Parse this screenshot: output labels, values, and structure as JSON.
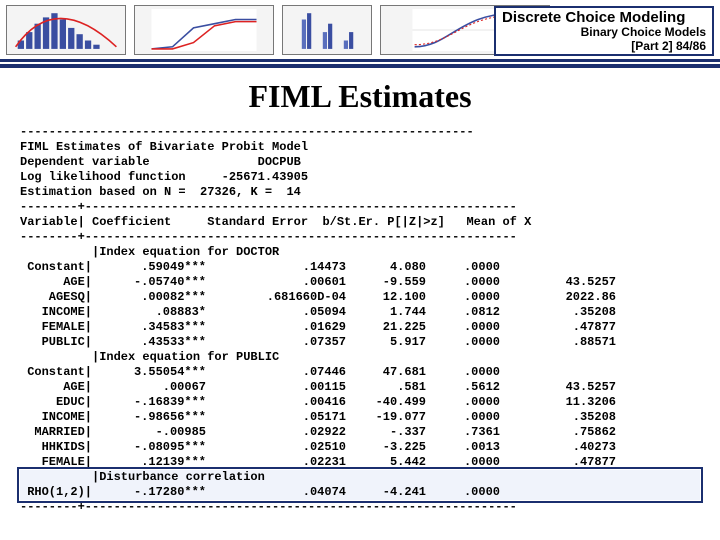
{
  "header": {
    "title_line1": "Discrete Choice Modeling",
    "title_line2": "Binary Choice Models",
    "part_label": "[Part 2]   84/86"
  },
  "main_title": "FIML Estimates",
  "preamble": {
    "dash_line": "---------------------------------------------------------------",
    "l1": "FIML Estimates of Bivariate Probit Model",
    "l2": "Dependent variable               DOCPUB",
    "l3": "Log likelihood function     -25671.43905",
    "l4": "Estimation based on N =  27326, K =  14",
    "sep": "--------+------------------------------------------------------------",
    "colhead": "Variable| Coefficient     Standard Error  b/St.Er. P[|Z|>z]   Mean of X"
  },
  "section1_label": "|Index     equation for DOCTOR",
  "section2_label": "|Index     equation for PUBLIC",
  "section3_label": "|Disturbance correlation",
  "closing_sep": "--------+------------------------------------------------------------",
  "rows_doctor": [
    {
      "var": "Constant|",
      "coef": ".59049***",
      "se": ".14473",
      "t": "4.080",
      "p": ".0000",
      "mx": ""
    },
    {
      "var": "AGE|",
      "coef": "-.05740***",
      "se": ".00601",
      "t": "-9.559",
      "p": ".0000",
      "mx": "43.5257"
    },
    {
      "var": "AGESQ|",
      "coef": ".00082***",
      "se": ".681660D-04",
      "t": "12.100",
      "p": ".0000",
      "mx": "2022.86"
    },
    {
      "var": "INCOME|",
      "coef": ".08883*",
      "se": ".05094",
      "t": "1.744",
      "p": ".0812",
      "mx": ".35208"
    },
    {
      "var": "FEMALE|",
      "coef": ".34583***",
      "se": ".01629",
      "t": "21.225",
      "p": ".0000",
      "mx": ".47877"
    },
    {
      "var": "PUBLIC|",
      "coef": ".43533***",
      "se": ".07357",
      "t": "5.917",
      "p": ".0000",
      "mx": ".88571"
    }
  ],
  "rows_public": [
    {
      "var": "Constant|",
      "coef": "3.55054***",
      "se": ".07446",
      "t": "47.681",
      "p": ".0000",
      "mx": ""
    },
    {
      "var": "AGE|",
      "coef": ".00067",
      "se": ".00115",
      "t": ".581",
      "p": ".5612",
      "mx": "43.5257"
    },
    {
      "var": "EDUC|",
      "coef": "-.16839***",
      "se": ".00416",
      "t": "-40.499",
      "p": ".0000",
      "mx": "11.3206"
    },
    {
      "var": "INCOME|",
      "coef": "-.98656***",
      "se": ".05171",
      "t": "-19.077",
      "p": ".0000",
      "mx": ".35208"
    },
    {
      "var": "MARRIED|",
      "coef": "-.00985",
      "se": ".02922",
      "t": "-.337",
      "p": ".7361",
      "mx": ".75862"
    },
    {
      "var": "HHKIDS|",
      "coef": "-.08095***",
      "se": ".02510",
      "t": "-3.225",
      "p": ".0013",
      "mx": ".40273"
    },
    {
      "var": "FEMALE|",
      "coef": ".12139***",
      "se": ".02231",
      "t": "5.442",
      "p": ".0000",
      "mx": ".47877"
    }
  ],
  "row_rho": {
    "var": "RHO(1,2)|",
    "coef": "-.17280***",
    "se": ".04074",
    "t": "-4.241",
    "p": ".0000",
    "mx": ""
  }
}
